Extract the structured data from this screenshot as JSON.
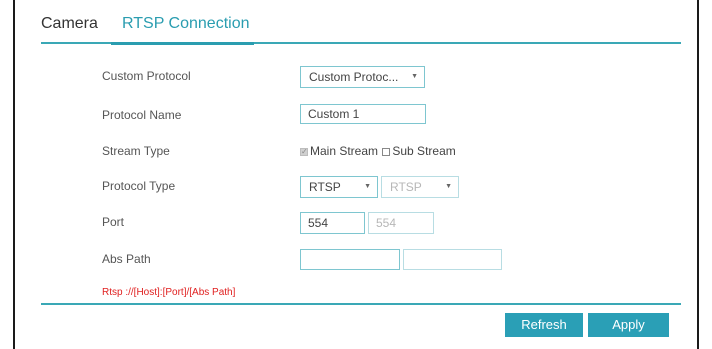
{
  "tabs": [
    {
      "label": "Camera",
      "active": false
    },
    {
      "label": "RTSP Connection",
      "active": true
    }
  ],
  "form": {
    "custom_protocol": {
      "label": "Custom Protocol",
      "value": "Custom Protoc..."
    },
    "protocol_name": {
      "label": "Protocol Name",
      "value": "Custom 1"
    },
    "stream_type": {
      "label": "Stream Type",
      "main_stream": "Main Stream",
      "sub_stream": "Sub Stream",
      "main_checked": true,
      "sub_checked": false
    },
    "protocol_type": {
      "label": "Protocol Type",
      "primary": "RTSP",
      "secondary": "RTSP"
    },
    "port": {
      "label": "Port",
      "primary": "554",
      "secondary": "554"
    },
    "abs_path": {
      "label": "Abs Path",
      "primary": "",
      "secondary": ""
    }
  },
  "hint": "Rtsp ://[Host]:[Port]/[Abs Path]",
  "buttons": {
    "refresh": "Refresh",
    "apply": "Apply"
  },
  "colors": {
    "accent": "#2a9db0",
    "hint": "#e02020",
    "button": "#2a9fb6"
  }
}
